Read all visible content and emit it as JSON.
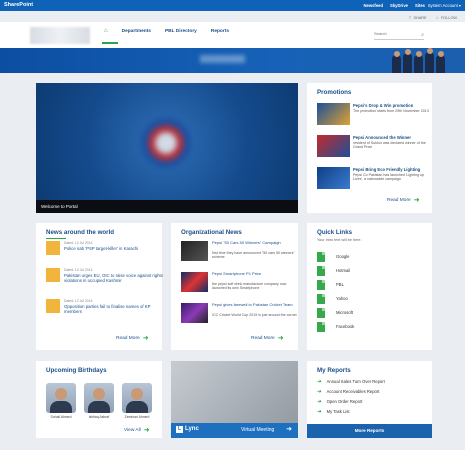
{
  "suite_bar": {
    "brand": "SharePoint",
    "links": [
      "Newsfeed",
      "SkyDrive",
      "Sites"
    ],
    "account": "System Account ▾"
  },
  "page_actions": {
    "share": "SHARE",
    "follow": "FOLLOW"
  },
  "nav": {
    "items": [
      "Departments",
      "PBL Directory",
      "Reports"
    ]
  },
  "search": {
    "placeholder": "Search"
  },
  "hero": {
    "caption": "Welcome to Portal"
  },
  "promotions": {
    "title": "Promotions",
    "items": [
      {
        "title": "Pepsi's Drop & Win promotion",
        "desc": "The promotion starts from 29th November 2013"
      },
      {
        "title": "Pepsi Announced the Winner",
        "desc": "resident of Sukkur was declared winner of the Grand Prize"
      },
      {
        "title": "Pepsi Bring Eco Friendly Lighting",
        "desc": "Pepsi Co Pakistan has launched 'Lighting up Lives', a nationwide campaign"
      }
    ],
    "more": "Read More"
  },
  "news": {
    "title": "News around the world",
    "items": [
      {
        "date": "Dated: 12 Jul 2014",
        "title": "Police nab 'PSP target-killer' in Karachi"
      },
      {
        "date": "Dated: 12 Jul 2014",
        "title": "Pakistan urges EU, OIC to raise voice against rights violations in occupied Kashmir"
      },
      {
        "date": "Dated: 12 Jul 2014",
        "title": "Opposition parties fail to finalise names of KP members"
      }
    ],
    "more": "Read More"
  },
  "org_news": {
    "title": "Organizational News",
    "items": [
      {
        "title": "Pepsi \"50 Cars 50 Winners\" Campaign",
        "desc": "first time they have announced \"50 cars 50 winners\" scheme"
      },
      {
        "title": "Pepsi Smartphone P1 Price",
        "desc": "the pepsi soft drink manufacture company now launched its own Smartphone"
      },
      {
        "title": "Pepsi gives farewell to Pakistan Cricket Team",
        "desc": "ICC Cricket World Cup 2015 is just around the corner"
      }
    ],
    "more": "Read More"
  },
  "quick_links": {
    "title": "Quick Links",
    "intro": "Your intro text will be here.",
    "items": [
      "Google",
      "Hotmail",
      "PBL",
      "Yahoo",
      "Microsoft",
      "Facebook"
    ]
  },
  "birthdays": {
    "title": "Upcoming Birthdays",
    "people": [
      "Sohail Ahmed",
      "Ishtiaq Ashraf",
      "Zeeshan Ahmed"
    ],
    "more": "View All"
  },
  "lync": {
    "badge": "Lync",
    "label": "Virtual Meeting"
  },
  "reports": {
    "title": "My Reports",
    "items": [
      "Annual Sales Turn Over Report",
      "Account Receivables Report",
      "Open Order Report",
      "My Task List"
    ],
    "button": "More Reports"
  },
  "colors": {
    "suite_blue": "#0e62b8",
    "nav_blue": "#1b4f8a",
    "accent_green": "#2fa34a",
    "page_bg": "#eaeef3"
  }
}
